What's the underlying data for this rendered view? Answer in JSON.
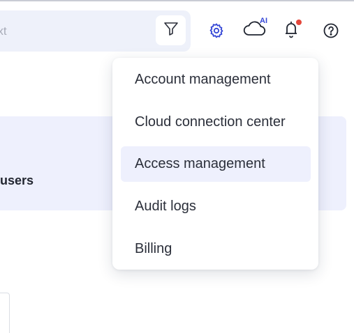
{
  "search": {
    "placeholder": "n text"
  },
  "header": {
    "cloud_badge": "AI"
  },
  "background": {
    "users_label": "users"
  },
  "menu": {
    "items": [
      {
        "label": "Account management",
        "active": false
      },
      {
        "label": "Cloud connection center",
        "active": false
      },
      {
        "label": "Access management",
        "active": true
      },
      {
        "label": "Audit logs",
        "active": false
      },
      {
        "label": "Billing",
        "active": false
      }
    ]
  },
  "colors": {
    "accent": "#3547d6",
    "notification_dot": "#e4473b",
    "highlight_bg": "#eef0fd",
    "search_bg": "#eef1fa"
  },
  "icons": [
    "filter-icon",
    "gear-icon",
    "cloud-ai-icon",
    "bell-icon",
    "help-icon"
  ]
}
